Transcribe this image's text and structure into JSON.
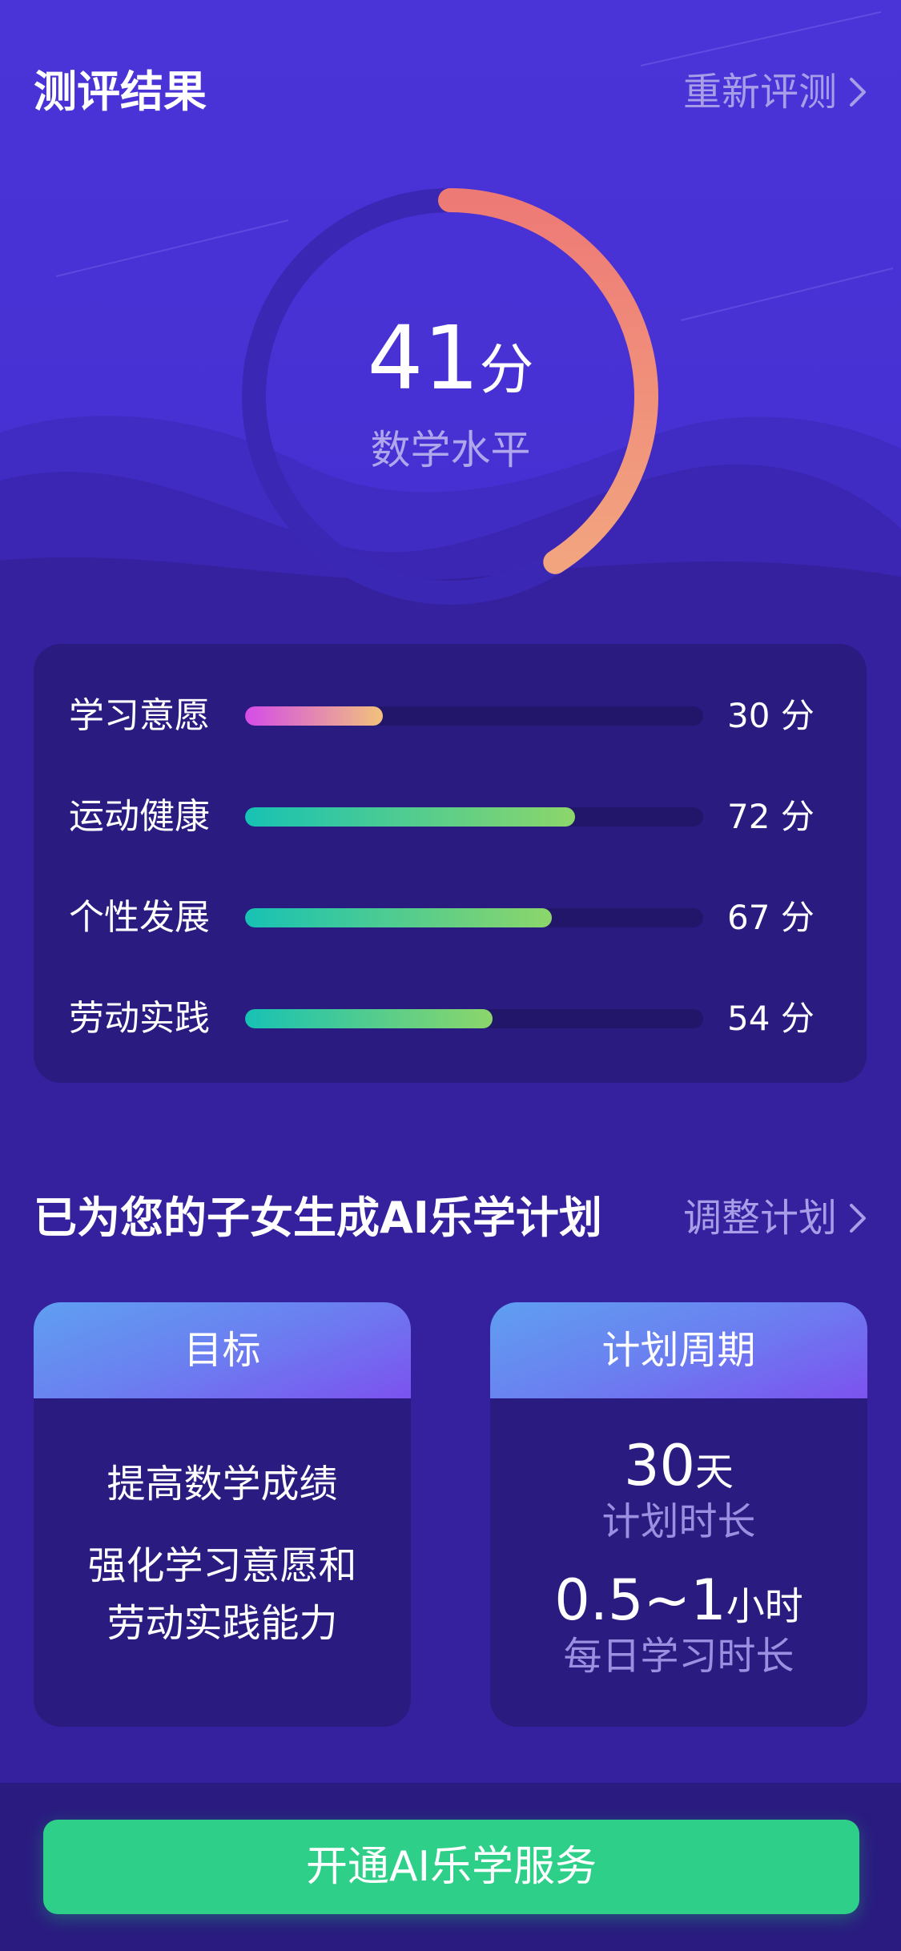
{
  "header": {
    "title": "测评结果",
    "retest_label": "重新评测",
    "retest_icon": "chevron-right-icon"
  },
  "score": {
    "value": "41",
    "unit": "分",
    "label": "数学水平",
    "progress": 0.41
  },
  "metrics": [
    {
      "label": "学习意愿",
      "value": "30",
      "unit": "分",
      "progress": 0.3,
      "colors": [
        "#d44ce8",
        "#f2c27c"
      ]
    },
    {
      "label": "运动健康",
      "value": "72",
      "unit": "分",
      "progress": 0.72,
      "colors": [
        "#17c2b4",
        "#8cd66a"
      ]
    },
    {
      "label": "个性发展",
      "value": "67",
      "unit": "分",
      "progress": 0.67,
      "colors": [
        "#17c2b4",
        "#8cd66a"
      ]
    },
    {
      "label": "劳动实践",
      "value": "54",
      "unit": "分",
      "progress": 0.54,
      "colors": [
        "#17c2b4",
        "#8cd66a"
      ]
    }
  ],
  "plan": {
    "title": "已为您的子女生成AI乐学计划",
    "adjust_label": "调整计划",
    "goal": {
      "header": "目标",
      "lines": [
        "提高数学成绩",
        "强化学习意愿和",
        "劳动实践能力"
      ]
    },
    "period": {
      "header": "计划周期",
      "duration_value": "30",
      "duration_unit": "天",
      "duration_label": "计划时长",
      "daily_value": "0.5~1",
      "daily_unit": "小时",
      "daily_label": "每日学习时长"
    }
  },
  "cta": {
    "label": "开通AI乐学服务"
  },
  "colors": {
    "background_top": "#4a33d6",
    "background_bottom": "#35219a",
    "card": "#2a1b80",
    "gauge_start": "#ee7a76",
    "gauge_end": "#f2a27e",
    "cta": "#2dcf89",
    "muted_text": "#a89ee8"
  }
}
